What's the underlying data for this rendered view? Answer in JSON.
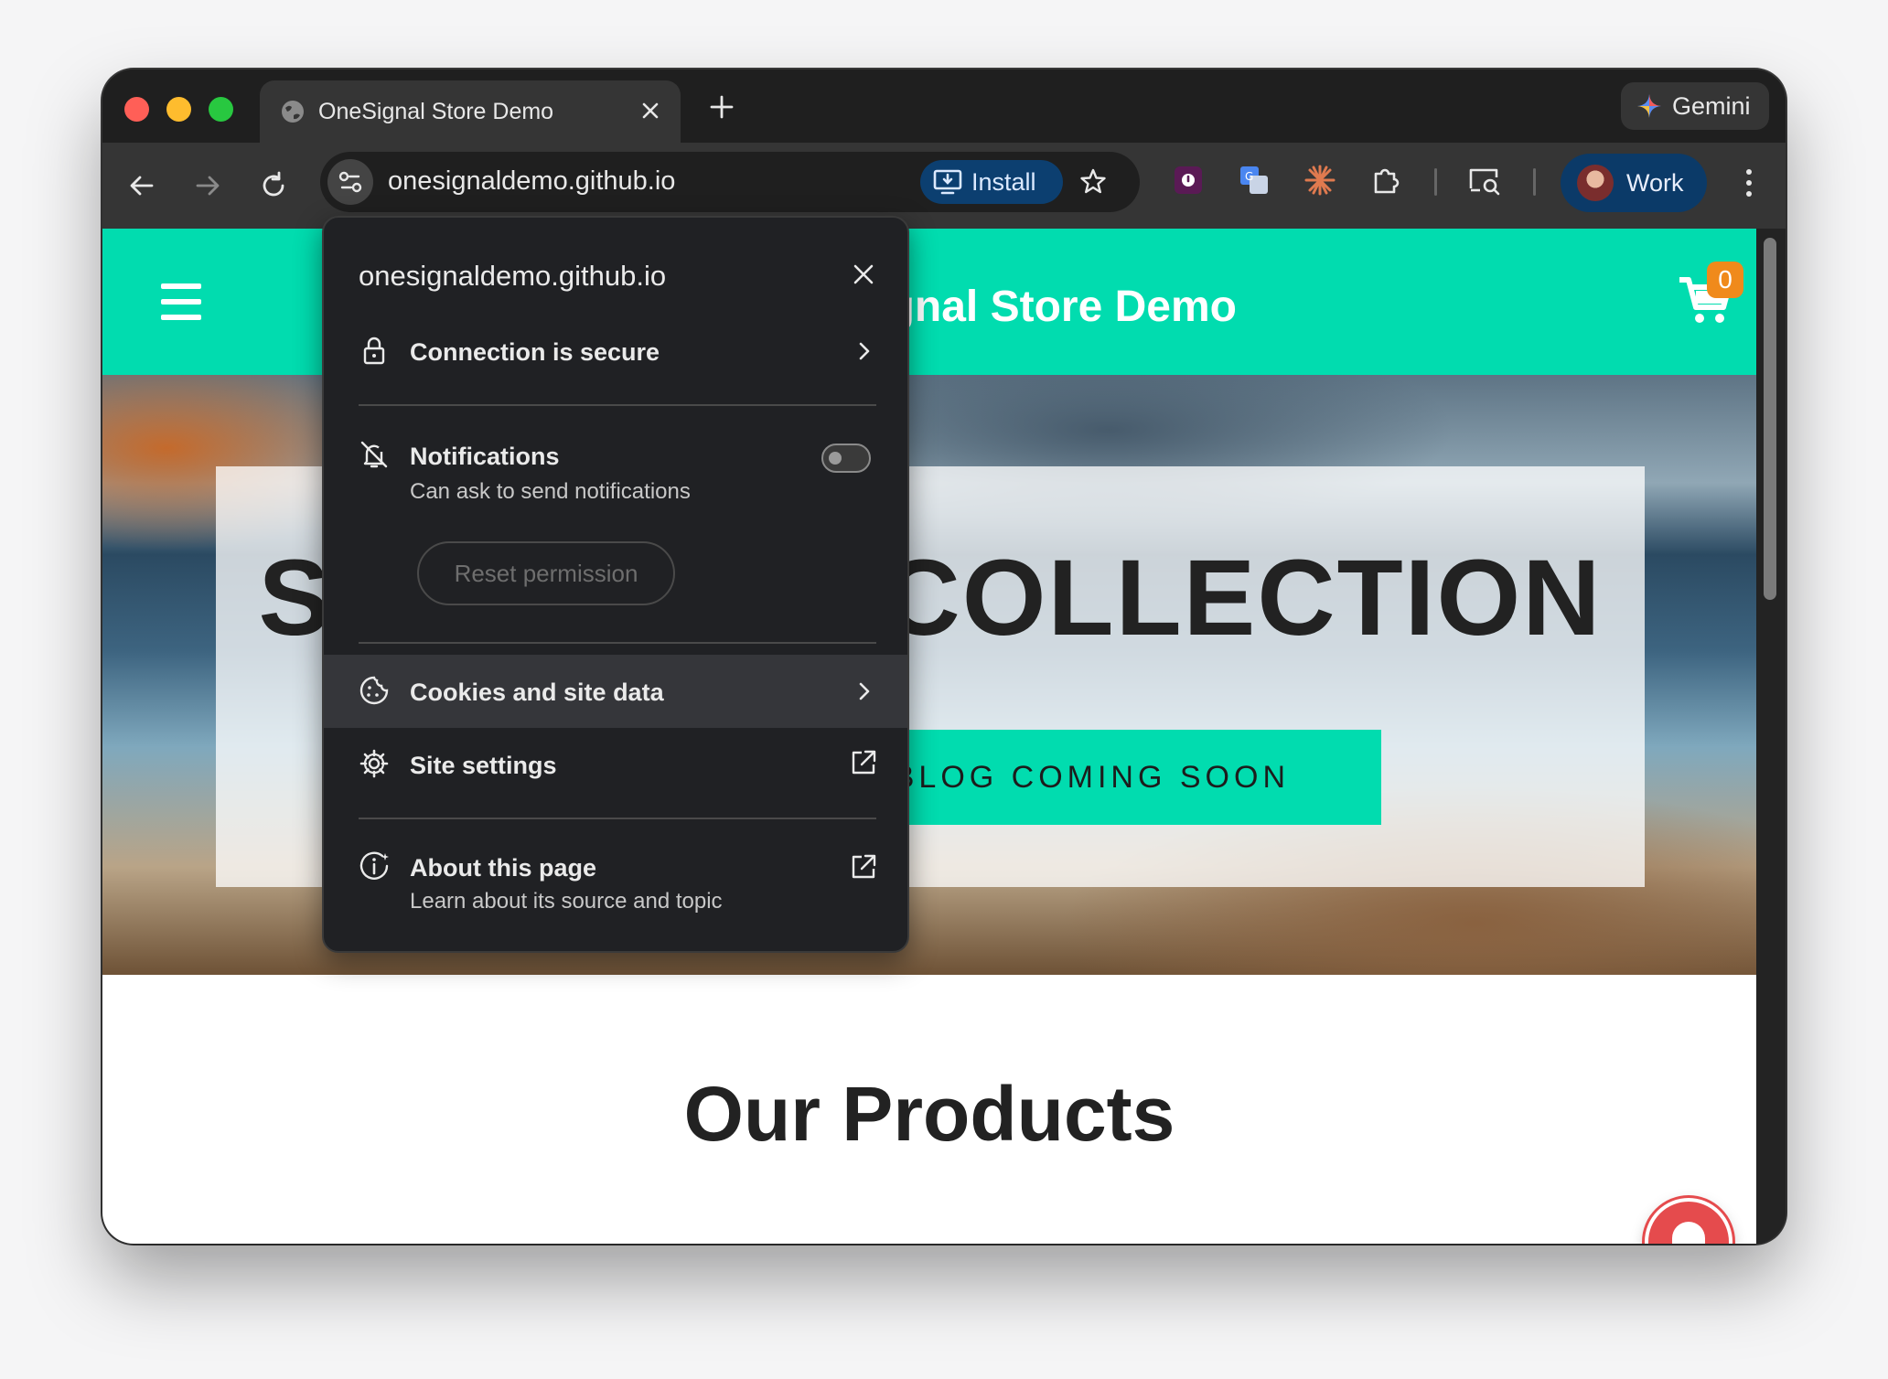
{
  "browser": {
    "tab": {
      "title": "OneSignal Store Demo"
    },
    "gemini_label": "Gemini",
    "url": "onesignaldemo.github.io",
    "install_label": "Install",
    "profile_label": "Work"
  },
  "site": {
    "header_title": "OneSignal Store Demo",
    "cart_count": "0",
    "hero_title": "SUMMER'S COLLECTION",
    "hero_button": "BLOG COMING SOON",
    "products_heading": "Our Products"
  },
  "popup": {
    "domain": "onesignaldemo.github.io",
    "connection": "Connection is secure",
    "notifications": {
      "label": "Notifications",
      "sub": "Can ask to send notifications",
      "toggle_on": false
    },
    "reset_label": "Reset permission",
    "cookies": "Cookies and site data",
    "site_settings": "Site settings",
    "about": {
      "label": "About this page",
      "sub": "Learn about its source and topic"
    }
  },
  "colors": {
    "accent": "#01dcaf",
    "badge": "#f08a1b",
    "bell": "#e54b4d",
    "install_bg": "#0c3f70"
  },
  "icons": [
    "globe-icon",
    "close-icon",
    "plus-icon",
    "gemini-sparkle-icon",
    "back-arrow-icon",
    "forward-arrow-icon",
    "reload-icon",
    "site-tune-icon",
    "install-icon",
    "bookmark-star-icon",
    "extension-icon",
    "puzzle-icon",
    "cast-search-icon",
    "kebab-menu-icon",
    "hamburger-icon",
    "cart-icon",
    "bell-icon",
    "lock-icon",
    "bell-off-icon",
    "cookie-icon",
    "gear-icon",
    "external-link-icon",
    "info-icon",
    "chevron-right-icon"
  ]
}
